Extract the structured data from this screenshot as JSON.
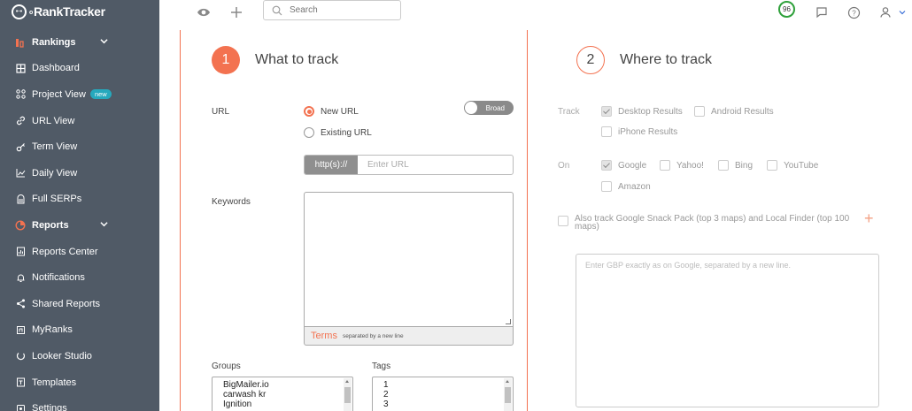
{
  "app": {
    "logo_text": "RankTracker",
    "logo_prefix": "o"
  },
  "sidebar": {
    "items": [
      {
        "label": "Rankings",
        "icon": "rankings-icon",
        "section": true,
        "expand": true
      },
      {
        "label": "Dashboard",
        "icon": "dashboard-icon"
      },
      {
        "label": "Project View",
        "icon": "project-view-icon",
        "badge": "new"
      },
      {
        "label": "URL View",
        "icon": "link-icon"
      },
      {
        "label": "Term View",
        "icon": "key-icon"
      },
      {
        "label": "Daily View",
        "icon": "line-chart-icon"
      },
      {
        "label": "Full SERPs",
        "icon": "serp-icon"
      },
      {
        "label": "Reports",
        "icon": "pie-chart-icon",
        "section": true,
        "expand": true
      },
      {
        "label": "Reports Center",
        "icon": "report-icon"
      },
      {
        "label": "Notifications",
        "icon": "bell-icon"
      },
      {
        "label": "Shared Reports",
        "icon": "share-icon"
      },
      {
        "label": "MyRanks",
        "icon": "myranks-icon"
      },
      {
        "label": "Looker Studio",
        "icon": "looker-icon"
      },
      {
        "label": "Templates",
        "icon": "template-icon"
      },
      {
        "label": "Settings",
        "icon": "settings-icon"
      }
    ]
  },
  "topbar": {
    "search_placeholder": "Search",
    "score": "96"
  },
  "what_to_track": {
    "step": "1",
    "title": "What to track",
    "url_label": "URL",
    "new_url": "New URL",
    "existing_url": "Existing URL",
    "url_mode": "new",
    "broad_toggle": "Broad",
    "url_prefix": "http(s)://",
    "url_placeholder": "Enter URL",
    "keywords_label": "Keywords",
    "terms_label": "Terms",
    "terms_hint": "separated by a new line",
    "groups_label": "Groups",
    "groups": [
      "BigMailer.io",
      "carwash kr",
      "Ignition"
    ],
    "tags_label": "Tags",
    "tags": [
      "1",
      "2",
      "3"
    ]
  },
  "where_to_track": {
    "step": "2",
    "title": "Where to track",
    "track_label": "Track",
    "track_options": [
      {
        "label": "Desktop Results",
        "checked": true
      },
      {
        "label": "Android Results",
        "checked": false
      },
      {
        "label": "iPhone Results",
        "checked": false
      }
    ],
    "on_label": "On",
    "engines": [
      {
        "label": "Google",
        "checked": true
      },
      {
        "label": "Yahoo!",
        "checked": false
      },
      {
        "label": "Bing",
        "checked": false
      },
      {
        "label": "YouTube",
        "checked": false
      },
      {
        "label": "Amazon",
        "checked": false
      }
    ],
    "snack_pack_label": "Also track Google Snack Pack (top 3 maps) and Local Finder (top 100 maps)",
    "gbp_placeholder": "Enter GBP exactly as on Google, separated by a new line."
  }
}
